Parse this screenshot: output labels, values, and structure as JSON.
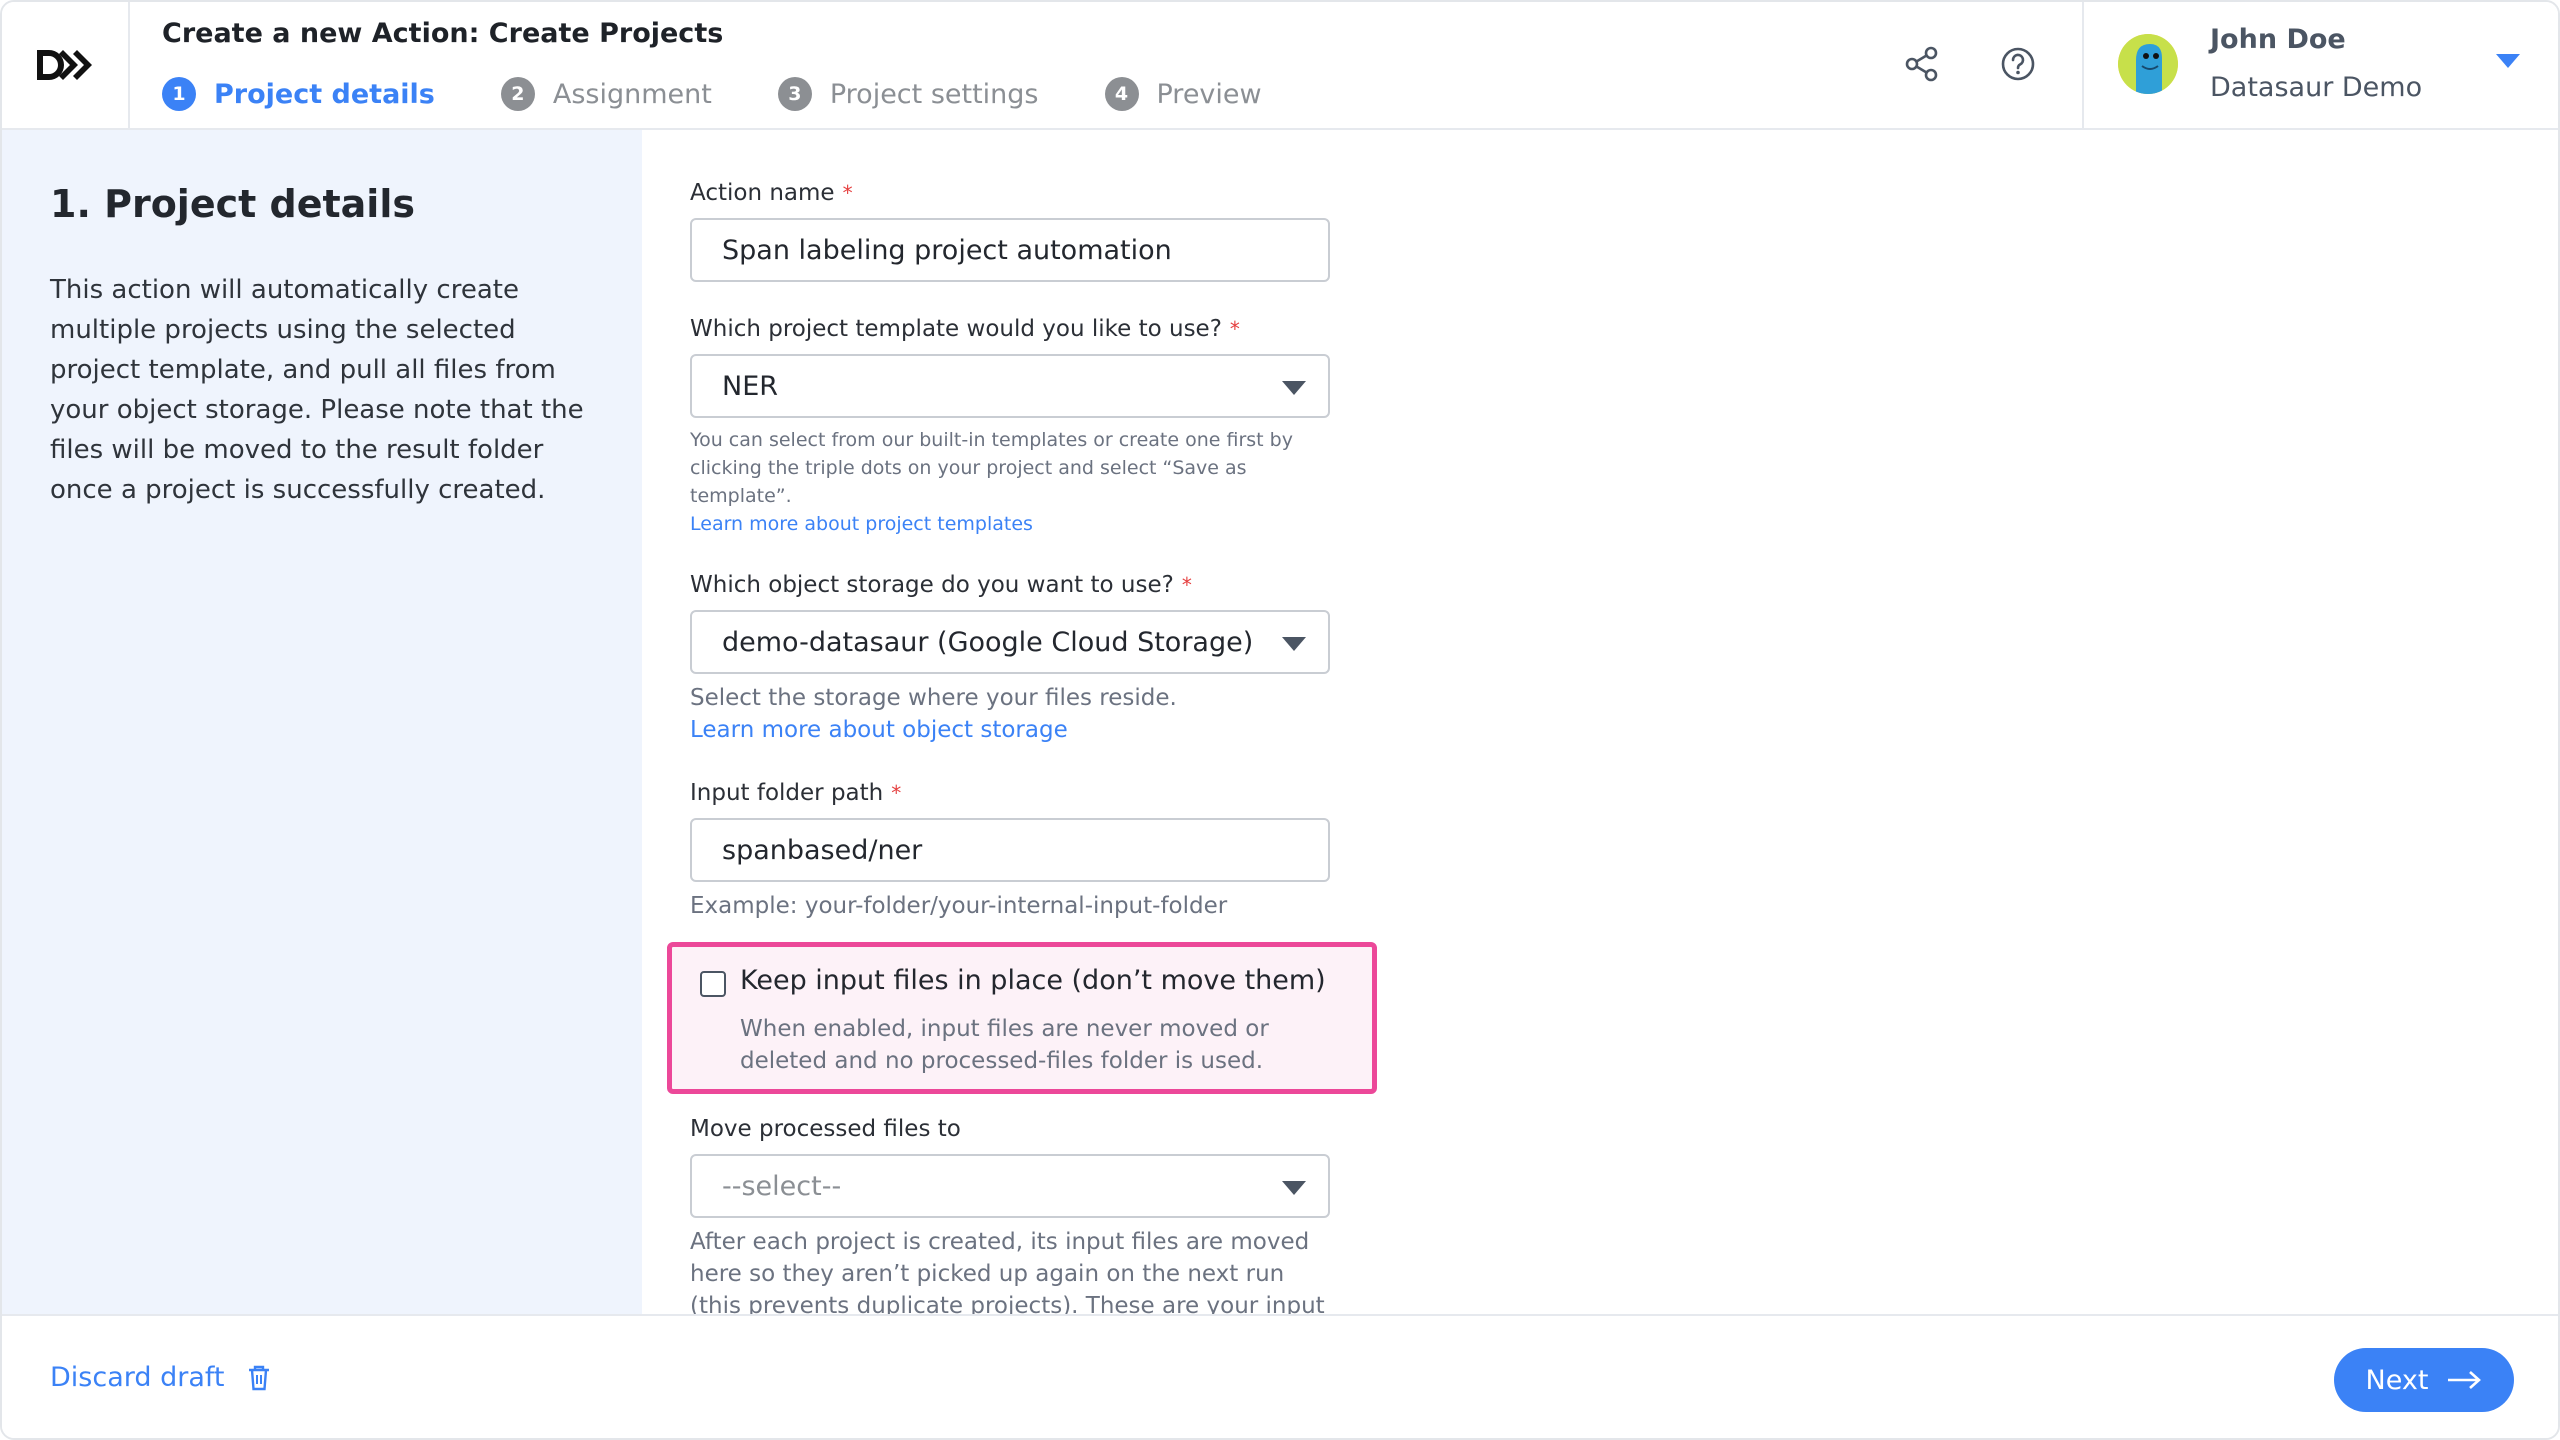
{
  "header": {
    "logo": "D▶▶",
    "title": "Create a new Action: Create Projects",
    "steps": [
      {
        "num": "1",
        "label": "Project details",
        "active": true
      },
      {
        "num": "2",
        "label": "Assignment",
        "active": false
      },
      {
        "num": "3",
        "label": "Project settings",
        "active": false
      },
      {
        "num": "4",
        "label": "Preview",
        "active": false
      }
    ],
    "icons": [
      "share-icon",
      "help-icon"
    ],
    "user": {
      "name": "John Doe",
      "org": "Datasaur Demo"
    }
  },
  "left_panel": {
    "title": "1. Project details",
    "description": "This action will automatically create multiple projects using the selected project template, and pull all files from your object storage. Please note that the files will be moved to the result folder once a project is successfully created."
  },
  "form": {
    "action_name": {
      "label": "Action name",
      "required": "*",
      "value": "Span labeling project automation"
    },
    "template": {
      "label": "Which project template would you like to use?",
      "required": "*",
      "value": "NER",
      "help": "You can select from our built-in templates or create one first by clicking the triple dots on your project and select “Save as template”.",
      "link": "Learn more about project templates"
    },
    "storage": {
      "label": "Which object storage do you want to use?",
      "required": "*",
      "value": "demo-datasaur (Google Cloud Storage)",
      "help": "Select the storage where your files reside.",
      "link": "Learn more about object storage"
    },
    "input_folder": {
      "label": "Input folder path",
      "required": "*",
      "value": "spanbased/ner",
      "help": "Example: your-folder/your-internal-input-folder"
    },
    "keep_in_place": {
      "label": "Keep input files in place (don’t move them)",
      "checked": false,
      "help": "When enabled, input files are never moved or deleted and no processed-files folder is used."
    },
    "move_processed": {
      "label": "Move processed files to",
      "placeholder": "--select--",
      "help": "After each project is created, its input files are moved here so they aren’t picked up again on the next run (this prevents duplicate projects). These are your input files"
    }
  },
  "footer": {
    "discard_label": "Discard draft",
    "next_label": "Next"
  },
  "colors": {
    "accent": "#3b82f6",
    "highlight_border": "#ec4899",
    "left_panel_bg": "#eff4fd"
  }
}
